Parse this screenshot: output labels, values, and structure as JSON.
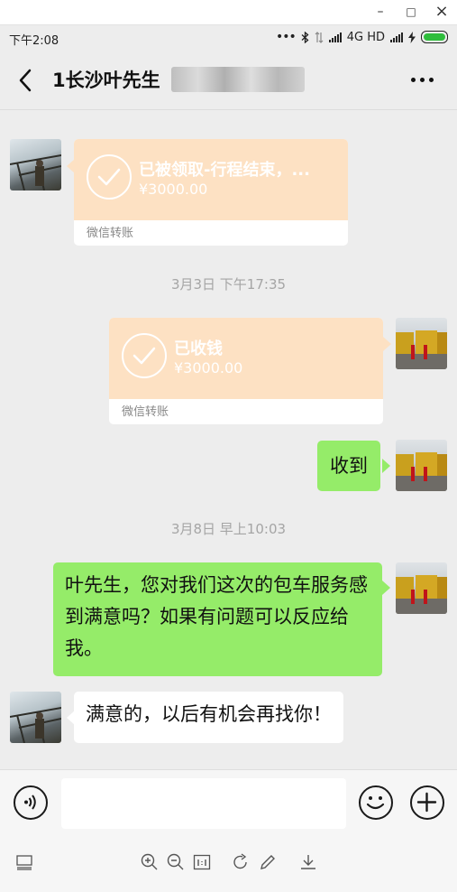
{
  "window": {
    "minimize": "–",
    "maximize": "□",
    "close": "×"
  },
  "status_bar": {
    "time": "下午2:08",
    "dots": "•••",
    "network": "4G HD"
  },
  "header": {
    "title": "1长沙叶先生"
  },
  "messages": {
    "transfer1": {
      "title": "已被领取-行程结束，...",
      "amount": "¥3000.00",
      "footer": "微信转账"
    },
    "time1": "3月3日 下午17:35",
    "transfer2": {
      "title": "已收钱",
      "amount": "¥3000.00",
      "footer": "微信转账"
    },
    "reply1": "收到",
    "time2": "3月8日 早上10:03",
    "msg_sent": "叶先生，您对我们这次的包车服务感到满意吗？如果有问题可以反应给我。",
    "msg_received": "满意的，以后有机会再找你！"
  },
  "colors": {
    "transfer": "#fde1c3",
    "sent_bubble": "#95ec69",
    "background": "#ededed"
  }
}
